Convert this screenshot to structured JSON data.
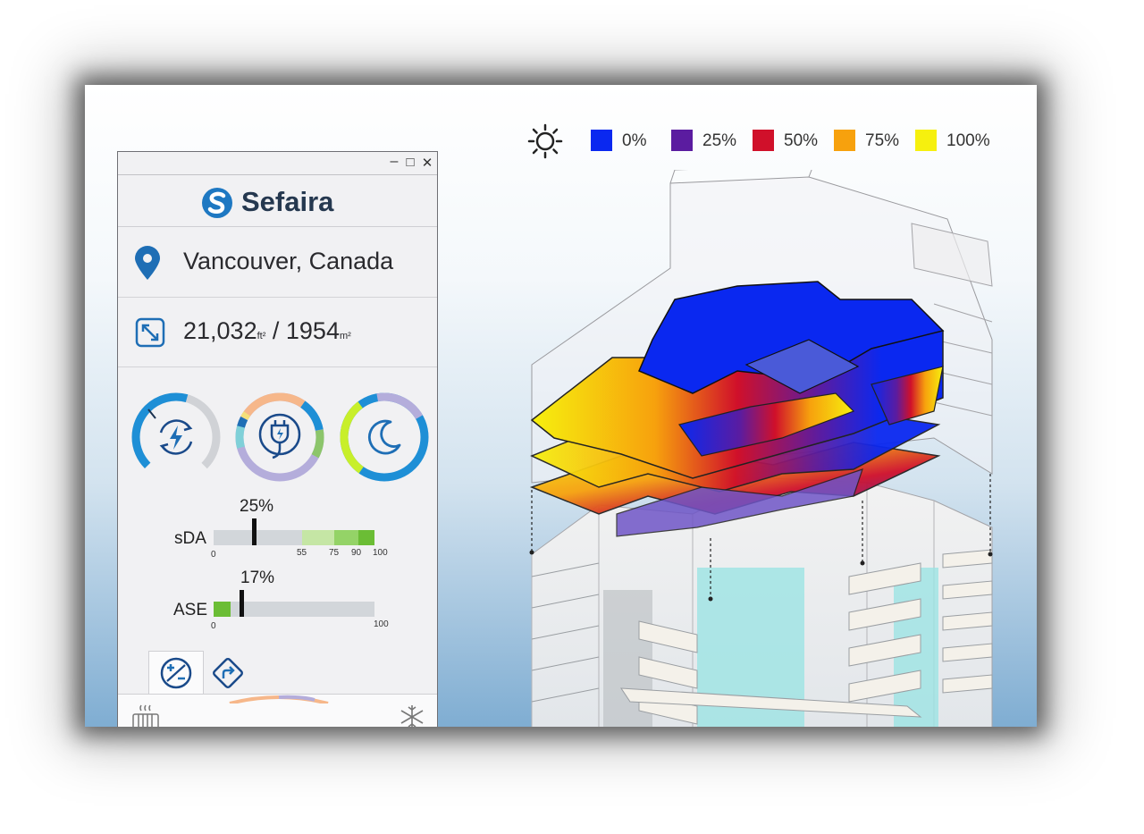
{
  "window": {
    "minimize": "–",
    "maximize": "□",
    "close": "✕"
  },
  "brand": {
    "name": "Sefaira"
  },
  "location": {
    "text": "Vancouver, Canada"
  },
  "area": {
    "imperial": "21,032",
    "imperial_unit": "ft²",
    "separator": " / ",
    "metric": "1954",
    "metric_unit": "m²"
  },
  "gauges": [
    {
      "name": "energy",
      "icon": "energy-cycle-icon",
      "ring_colors": [
        "#1e8fd6",
        "#d0d2d6"
      ]
    },
    {
      "name": "power",
      "icon": "plug-icon",
      "ring_colors": [
        "#f6b78a",
        "#1e8fd6",
        "#8cc56b",
        "#b4addb",
        "#7fd0d8",
        "#f4e07a"
      ]
    },
    {
      "name": "night",
      "icon": "moon-icon",
      "ring_colors": [
        "#b4addb",
        "#1e8fd6",
        "#c8ef2a"
      ]
    }
  ],
  "metrics": {
    "sda": {
      "label": "sDA",
      "percent": "25%",
      "value": 25,
      "ticks": [
        "0",
        "55",
        "75",
        "90",
        "100"
      ]
    },
    "ase": {
      "label": "ASE",
      "percent": "17%",
      "value": 17,
      "ticks": [
        "0",
        "100"
      ]
    }
  },
  "tabs": [
    {
      "icon": "plus-minus-icon",
      "active": true
    },
    {
      "icon": "route-icon",
      "active": false
    }
  ],
  "bottom_icons": [
    "radiator-icon",
    "snowflake-icon"
  ],
  "legend": {
    "sun_icon": "sun-icon",
    "items": [
      {
        "label": "0%",
        "color": "#0a28f0"
      },
      {
        "label": "25%",
        "color": "#5b1ca0"
      },
      {
        "label": "50%",
        "color": "#d0102a"
      },
      {
        "label": "75%",
        "color": "#f7a10d"
      },
      {
        "label": "100%",
        "color": "#f6f00e"
      }
    ]
  }
}
